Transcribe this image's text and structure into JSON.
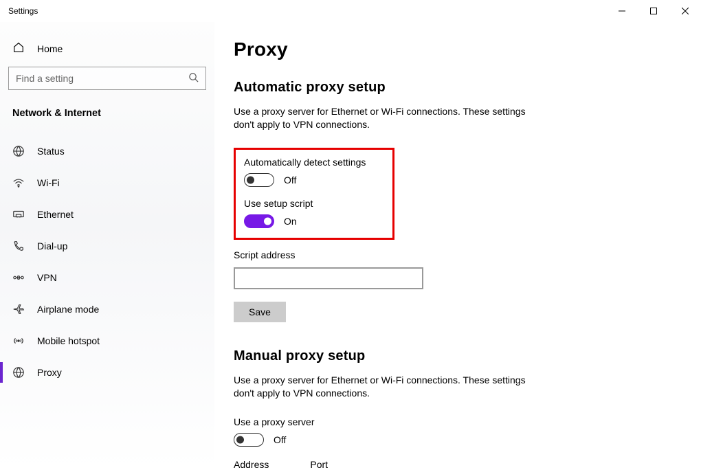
{
  "window": {
    "title": "Settings"
  },
  "sidebar": {
    "home_label": "Home",
    "search_placeholder": "Find a setting",
    "category": "Network & Internet",
    "items": [
      {
        "label": "Status",
        "icon": "status"
      },
      {
        "label": "Wi-Fi",
        "icon": "wifi"
      },
      {
        "label": "Ethernet",
        "icon": "ethernet"
      },
      {
        "label": "Dial-up",
        "icon": "dialup"
      },
      {
        "label": "VPN",
        "icon": "vpn"
      },
      {
        "label": "Airplane mode",
        "icon": "airplane"
      },
      {
        "label": "Mobile hotspot",
        "icon": "hotspot"
      },
      {
        "label": "Proxy",
        "icon": "proxy"
      }
    ]
  },
  "page": {
    "title": "Proxy",
    "auto": {
      "heading": "Automatic proxy setup",
      "desc": "Use a proxy server for Ethernet or Wi-Fi connections. These settings don't apply to VPN connections.",
      "detect_label": "Automatically detect settings",
      "detect_state": "Off",
      "script_label": "Use setup script",
      "script_state": "On",
      "addr_label": "Script address",
      "addr_value": "",
      "save_label": "Save"
    },
    "manual": {
      "heading": "Manual proxy setup",
      "desc": "Use a proxy server for Ethernet or Wi-Fi connections. These settings don't apply to VPN connections.",
      "use_label": "Use a proxy server",
      "use_state": "Off",
      "address_label": "Address",
      "port_label": "Port"
    }
  }
}
